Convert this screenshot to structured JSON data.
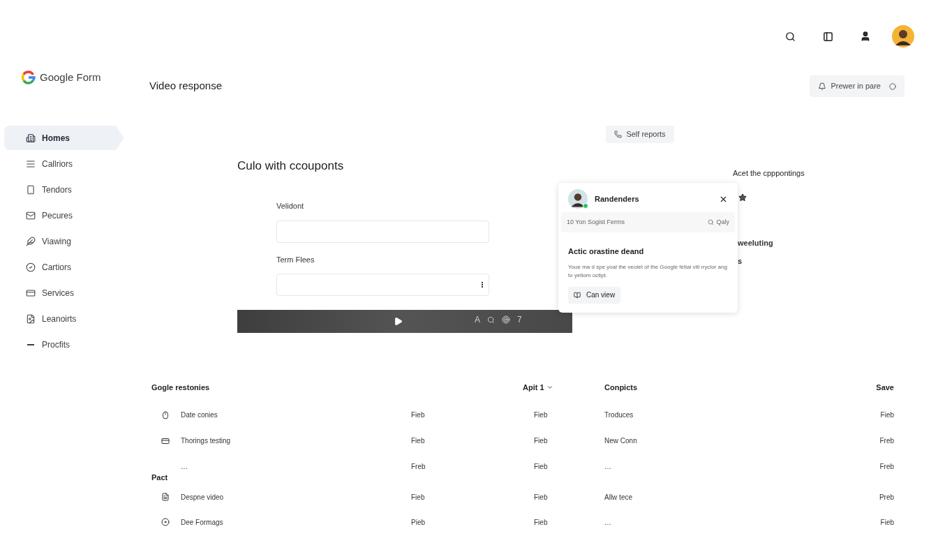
{
  "app": {
    "logo_text": "Google Form"
  },
  "sidebar": {
    "items": [
      {
        "label": "Homes",
        "selected": true
      },
      {
        "label": "Callriors",
        "selected": false
      },
      {
        "label": "Tendors",
        "selected": false
      },
      {
        "label": "Pecures",
        "selected": false
      },
      {
        "label": "Viawing",
        "selected": false
      },
      {
        "label": "Cartiors",
        "selected": false
      },
      {
        "label": "Services",
        "selected": false
      },
      {
        "label": "Leanoirts",
        "selected": false
      },
      {
        "label": "Procfits",
        "selected": false
      }
    ]
  },
  "page": {
    "title": "Video response",
    "preview_button": "Prewer in pare",
    "self_reports_button": "Self reports"
  },
  "form": {
    "heading": "Culo with ccouponts",
    "fields": [
      {
        "label": "Velidont",
        "kind": "text"
      },
      {
        "label": "Term Flees",
        "kind": "select"
      }
    ]
  },
  "player": {
    "controls": [
      {
        "kind": "text",
        "label": "A"
      },
      {
        "kind": "search"
      },
      {
        "kind": "target"
      },
      {
        "kind": "text",
        "label": "7"
      }
    ]
  },
  "popup": {
    "name": "Randenders",
    "online": true,
    "search_text": "10 Yon Sogist Ferms",
    "search_action": "Qaly",
    "title": "Actic orastine deand",
    "body": "Youe ma d spe yoal the veolet of the Google fetial vitl ıryclor ang to yetiom octipt.",
    "button": "Can view"
  },
  "right_panel": {
    "heading": "Acet the cpppontings",
    "items": [
      "weeluting",
      "s"
    ]
  },
  "table": {
    "header": {
      "column_1": "Gogle restonies",
      "column_3": "Apit 1",
      "column_4": "Conpicts",
      "column_5": "Save"
    },
    "rows": [
      {
        "kind": "item",
        "name": "Date conies",
        "cells": [
          "Fieb",
          "Fieb",
          "Troduces",
          "Fieb"
        ]
      },
      {
        "kind": "item",
        "name": "Thorings testing",
        "cells": [
          "Fieb",
          "Fieb",
          "New Conn",
          "Freb"
        ]
      },
      {
        "kind": "more",
        "name": "…",
        "cells": [
          "Freb",
          "Fieb",
          "…",
          "Freb"
        ]
      },
      {
        "kind": "group",
        "name": "Pact"
      },
      {
        "kind": "item",
        "name": "Despne video",
        "cells": [
          "Fieb",
          "Fieb",
          "Allw tece",
          "Preb"
        ]
      },
      {
        "kind": "item",
        "name": "Dee Formags",
        "cells": [
          "Pieb",
          "Fieb",
          "…",
          "Fieb"
        ]
      }
    ]
  }
}
